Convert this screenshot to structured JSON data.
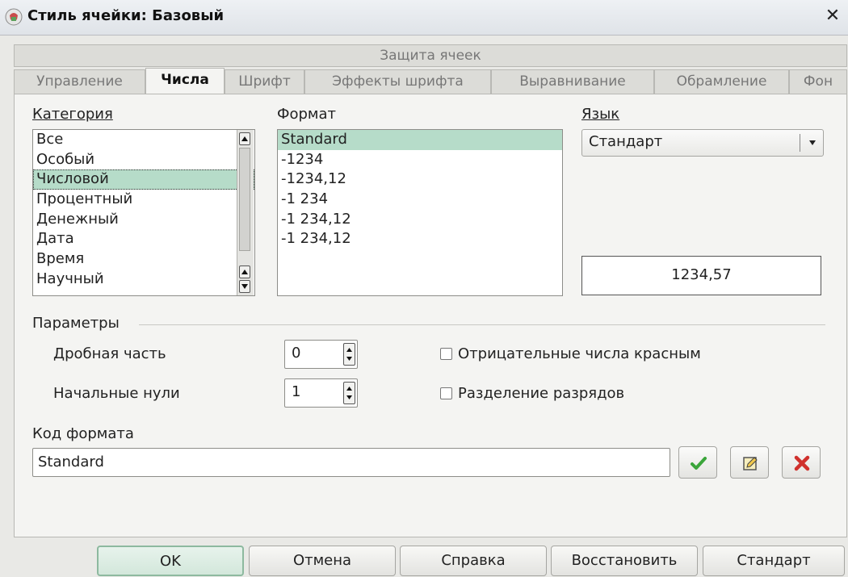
{
  "window": {
    "title": "Стиль ячейки: Базовый",
    "icon": "calc-app-icon",
    "close_glyph": "✕"
  },
  "tabs_top": [
    {
      "label": "Защита ячеек"
    }
  ],
  "tabs": [
    {
      "label": "Управление",
      "active": false
    },
    {
      "label": "Числа",
      "active": true
    },
    {
      "label": "Шрифт",
      "active": false
    },
    {
      "label": "Эффекты шрифта",
      "active": false
    },
    {
      "label": "Выравнивание",
      "active": false
    },
    {
      "label": "Обрамление",
      "active": false
    },
    {
      "label": "Фон",
      "active": false
    }
  ],
  "category": {
    "label": "Категория",
    "items": [
      "Все",
      "Особый",
      "Числовой",
      "Процентный",
      "Денежный",
      "Дата",
      "Время",
      "Научный"
    ],
    "selected": "Числовой"
  },
  "format": {
    "label": "Формат",
    "items": [
      "Standard",
      "-1234",
      "-1234,12",
      "-1 234",
      "-1 234,12",
      "-1 234,12"
    ],
    "selected": "Standard"
  },
  "language": {
    "label": "Язык",
    "value": "Стандарт"
  },
  "preview": {
    "value": "1234,57"
  },
  "options": {
    "label": "Параметры",
    "decimal_places_label": "Дробная часть",
    "decimal_places_value": "0",
    "leading_zeros_label": "Начальные нули",
    "leading_zeros_value": "1",
    "negative_red_label": "Отрицательные числа красным",
    "negative_red_checked": false,
    "thousands_sep_label": "Разделение разрядов",
    "thousands_sep_checked": false
  },
  "format_code": {
    "label": "Код формата",
    "value": "Standard"
  },
  "buttons": {
    "ok": "OK",
    "cancel": "Отмена",
    "help": "Справка",
    "reset": "Восстановить",
    "standard": "Стандарт"
  },
  "colors": {
    "selection": "#b6dcc9",
    "accept_icon": "#3aa53a",
    "delete_icon": "#d0312d"
  }
}
